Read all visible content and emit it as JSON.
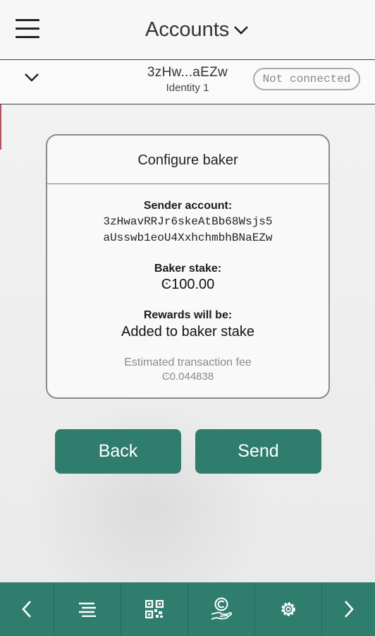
{
  "header": {
    "title": "Accounts"
  },
  "account_bar": {
    "address": "3zHw...aEZw",
    "identity": "Identity 1",
    "status": "Not connected"
  },
  "card": {
    "title": "Configure baker",
    "sender_label": "Sender account:",
    "sender_line1": "3zHwavRRJr6skeAtBb68Wsjs5",
    "sender_line2": "aUsswb1eoU4XxhchmbhBNaEZw",
    "stake_label": "Baker stake:",
    "stake_value": "Ͼ100.00",
    "rewards_label": "Rewards will be:",
    "rewards_value": "Added to baker stake",
    "fee_label": "Estimated transaction fee",
    "fee_value": "Ͼ0.044838"
  },
  "buttons": {
    "back": "Back",
    "send": "Send"
  },
  "footer": {
    "icons": [
      "chevron-left-icon",
      "list-icon",
      "qr-code-icon",
      "hand-coin-icon",
      "gear-icon",
      "chevron-right-icon"
    ]
  },
  "colors": {
    "accent": "#2f7d6d",
    "status_border": "#aaaaaa",
    "edge_marker": "#b7525e"
  }
}
